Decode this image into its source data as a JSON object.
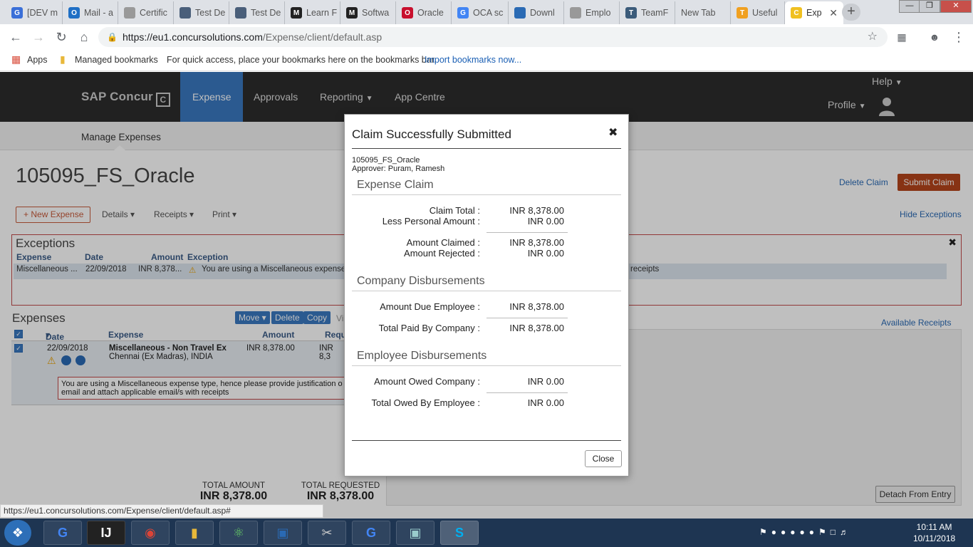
{
  "browser": {
    "tabs": [
      {
        "label": "[DEV m",
        "icon": "G",
        "color": "#3a6fd8"
      },
      {
        "label": "Mail - a",
        "icon": "O",
        "color": "#1f6fc5"
      },
      {
        "label": "Certific",
        "icon": "doc",
        "color": "#999"
      },
      {
        "label": "Test De",
        "icon": "check",
        "color": "#4a5f7a"
      },
      {
        "label": "Test De",
        "icon": "check",
        "color": "#4a5f7a"
      },
      {
        "label": "Learn F",
        "icon": "M",
        "color": "#222"
      },
      {
        "label": "Softwa",
        "icon": "M",
        "color": "#222"
      },
      {
        "label": "Oracle",
        "icon": "O",
        "color": "#c8102e"
      },
      {
        "label": "OCA sc",
        "icon": "G",
        "color": "#4285f4"
      },
      {
        "label": "Downl",
        "icon": "download",
        "color": "#2a6ab4"
      },
      {
        "label": "Emplo",
        "icon": "doc",
        "color": "#999"
      },
      {
        "label": "TeamF",
        "icon": "T",
        "color": "#3b5b7a"
      },
      {
        "label": "New Tab",
        "icon": "",
        "color": "#dee1e6"
      },
      {
        "label": "Useful",
        "icon": "T",
        "color": "#f0a020"
      },
      {
        "label": "Exp",
        "icon": "C",
        "color": "#f0c020"
      }
    ],
    "url_host": "https://eu1.concursolutions.com",
    "url_path": "/Expense/client/default.asp",
    "bookmarks": {
      "apps": "Apps",
      "managed": "Managed bookmarks",
      "hint": "For quick access, place your bookmarks here on the bookmarks bar.",
      "import_link": "Import bookmarks now..."
    },
    "status_url": "https://eu1.concursolutions.com/Expense/client/default.asp#"
  },
  "concur": {
    "logo": "SAP Concur",
    "nav": [
      "Expense",
      "Approvals",
      "Reporting",
      "App Centre"
    ],
    "help": "Help",
    "profile": "Profile",
    "subnav": "Manage Expenses"
  },
  "claim": {
    "title": "105095_FS_Oracle",
    "delete": "Delete Claim",
    "submit": "Submit Claim",
    "new_expense": "New Expense",
    "details": "Details",
    "receipts": "Receipts",
    "print": "Print",
    "hide_exceptions": "Hide Exceptions"
  },
  "exceptions": {
    "title": "Exceptions",
    "headers": [
      "Expense",
      "Date",
      "Amount",
      "Exception"
    ],
    "row": {
      "expense": "Miscellaneous ...",
      "date": "22/09/2018",
      "amount": "INR 8,378...",
      "exception": "You are using a Miscellaneous expense t",
      "exception_tail": "receipts"
    }
  },
  "expenses": {
    "title": "Expenses",
    "buttons": [
      "Move",
      "Delete",
      "Copy"
    ],
    "view_prefix": "Vi",
    "headers": [
      "Date",
      "Expense",
      "Amount",
      "Requ"
    ],
    "row": {
      "date": "22/09/2018",
      "name": "Miscellaneous - Non Travel Ex",
      "location": "Chennai (Ex Madras), INDIA",
      "amount": "INR 8,378.00",
      "requested": "INR 8,3"
    },
    "warning": "You are using a Miscellaneous expense type, hence please provide justification o",
    "warning_tail": "email and attach applicable email/s with receipts",
    "available_receipts": "Available Receipts",
    "detach": "Detach From Entry",
    "total_amount_label": "TOTAL AMOUNT",
    "total_amount": "INR 8,378.00",
    "total_requested_label": "TOTAL REQUESTED",
    "total_requested": "INR 8,378.00"
  },
  "modal": {
    "title": "Claim Successfully Submitted",
    "claim_name": "105095_FS_Oracle",
    "approver": "Approver: Puram, Ramesh",
    "sections": {
      "expense_claim": "Expense Claim",
      "company": "Company Disbursements",
      "employee": "Employee Disbursements"
    },
    "rows": {
      "claim_total": {
        "label": "Claim Total :",
        "value": "INR 8,378.00"
      },
      "less_personal": {
        "label": "Less Personal Amount :",
        "value": "INR 0.00"
      },
      "amount_claimed": {
        "label": "Amount Claimed :",
        "value": "INR 8,378.00"
      },
      "amount_rejected": {
        "label": "Amount Rejected :",
        "value": "INR 0.00"
      },
      "due_employee": {
        "label": "Amount Due Employee :",
        "value": "INR 8,378.00"
      },
      "paid_by_company": {
        "label": "Total Paid By Company :",
        "value": "INR 8,378.00"
      },
      "owed_company": {
        "label": "Amount Owed Company :",
        "value": "INR 0.00"
      },
      "owed_by_employee": {
        "label": "Total Owed By Employee :",
        "value": "INR 0.00"
      }
    },
    "close": "Close"
  },
  "taskbar": {
    "time": "10:11 AM",
    "date": "10/11/2018"
  }
}
